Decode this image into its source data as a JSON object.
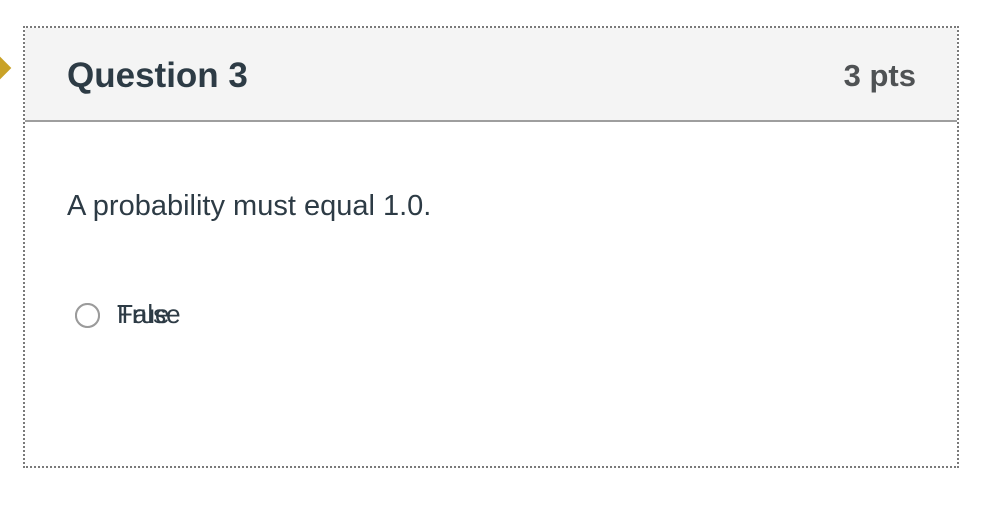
{
  "question": {
    "title": "Question 3",
    "points": "3 pts",
    "text": "A probability must equal 1.0."
  },
  "answers": [
    {
      "label": "True"
    },
    {
      "label": "False"
    }
  ],
  "colors": {
    "header_bg": "#f4f4f4",
    "text": "#2d3b45",
    "flag": "#c9a227"
  }
}
